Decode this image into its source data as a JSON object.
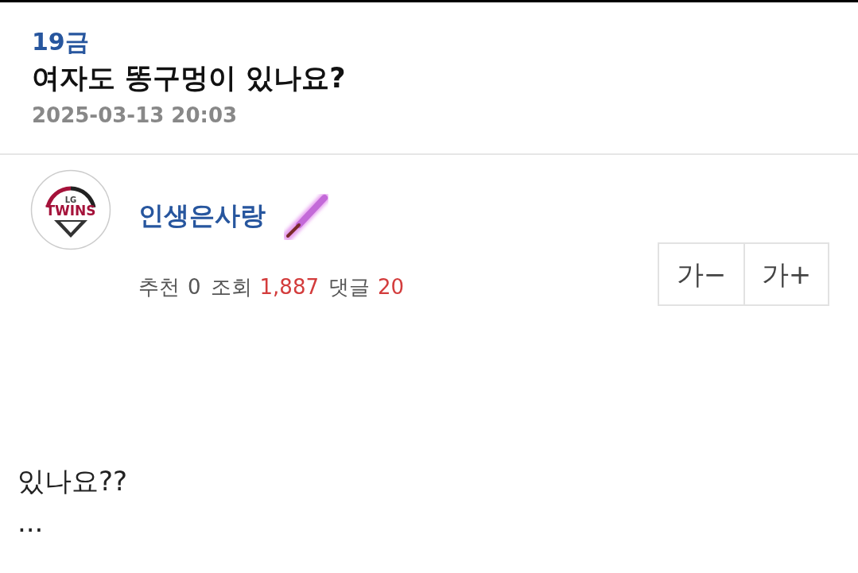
{
  "post": {
    "category": "19금",
    "title": "여자도 똥구멍이 있나요?",
    "date": "2025-03-13 20:03"
  },
  "author": {
    "name": "인생은사랑",
    "avatar_texts": [
      "LG",
      "TWINS"
    ]
  },
  "stats": [
    {
      "label": "추천",
      "value": "0",
      "highlight": false
    },
    {
      "label": "조회",
      "value": "1,887",
      "highlight": true
    },
    {
      "label": "댓글",
      "value": "20",
      "highlight": true
    }
  ],
  "font_buttons": [
    {
      "label": "가",
      "sign": "−"
    },
    {
      "label": "가",
      "sign": "+"
    }
  ],
  "body": [
    "있나요??",
    "..."
  ]
}
